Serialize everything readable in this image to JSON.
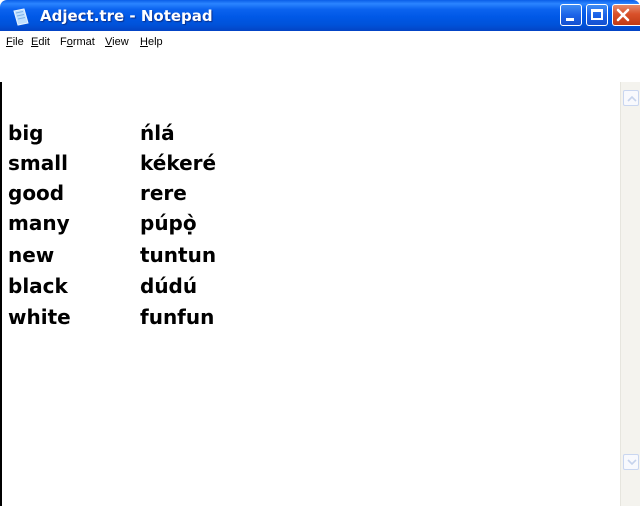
{
  "window": {
    "title": "Adject.tre - Notepad",
    "icon": "notepad-icon",
    "controls": [
      "minimize-icon",
      "maximize-icon",
      "close-icon"
    ]
  },
  "menu": {
    "file": {
      "u": "F",
      "rest": "ile"
    },
    "edit": {
      "u": "E",
      "rest": "dit"
    },
    "format": {
      "pre": "F",
      "u": "o",
      "rest": "rmat"
    },
    "view": {
      "u": "V",
      "rest": "iew"
    },
    "help": {
      "u": "H",
      "rest": "elp"
    }
  },
  "content": {
    "rows": [
      {
        "en": "big",
        "yo": "ńlá"
      },
      {
        "en": "small",
        "yo": "kékeré"
      },
      {
        "en": "good",
        "yo": "rere"
      },
      {
        "en": "many",
        "yo": "púpọ̀"
      },
      {
        "en": "new",
        "yo": "tuntun"
      },
      {
        "en": "black",
        "yo": "dúdú"
      },
      {
        "en": "white",
        "yo": "funfun"
      }
    ]
  },
  "scrollbar": {
    "up": "scroll-up-arrow-icon",
    "down": "scroll-down-arrow-icon"
  },
  "colors": {
    "titlebar": "#0058e6",
    "close_button": "#d9512a",
    "text": "#000000"
  }
}
